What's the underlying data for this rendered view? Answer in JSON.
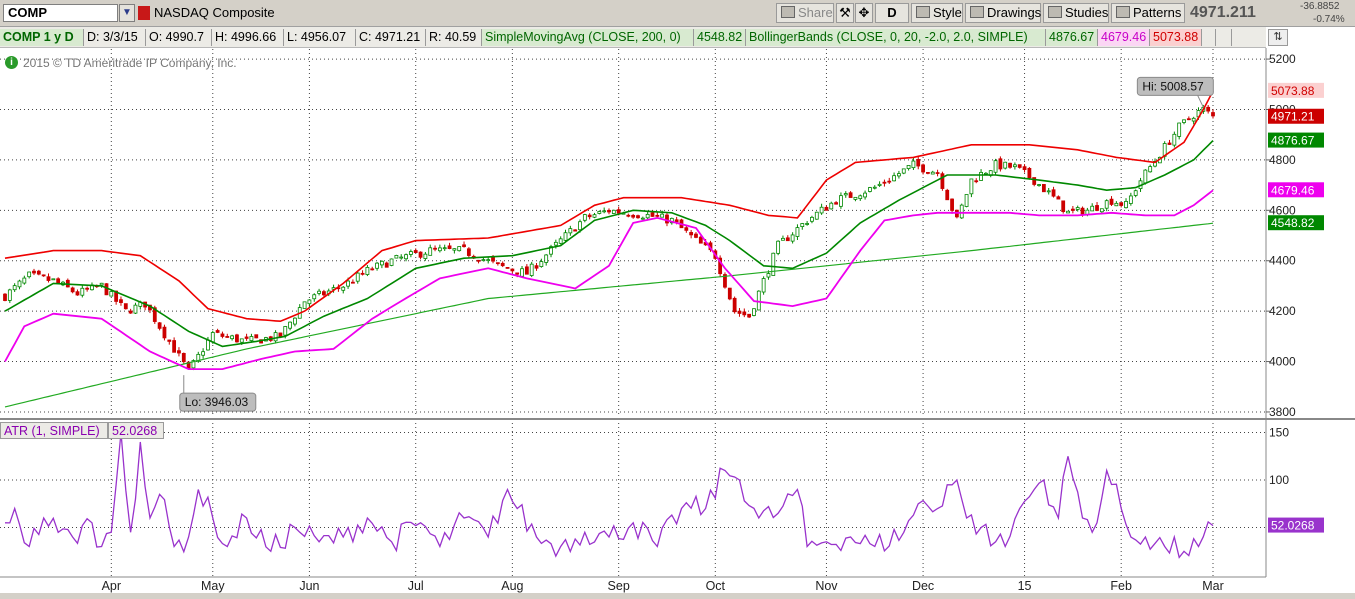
{
  "toolbar": {
    "symbol": "COMP",
    "symbol_name": "NASDAQ Composite",
    "share_label": "Share",
    "d_label": "D",
    "style_label": "Style",
    "drawings_label": "Drawings",
    "studies_label": "Studies",
    "patterns_label": "Patterns",
    "last_price": "4971.211",
    "net_change": "-36.8852",
    "pct_change": "-0.74%"
  },
  "info_bar": {
    "symbol_period": "COMP 1 y D",
    "date": "D: 3/3/15",
    "open": "O: 4990.7",
    "high": "H: 4996.66",
    "low": "L: 4956.07",
    "close": "C: 4971.21",
    "range": "R: 40.59",
    "sma_label": "SimpleMovingAvg (CLOSE, 200, 0)",
    "sma_value": "4548.82",
    "bb_label": "BollingerBands (CLOSE, 0, 20, -2.0, 2.0, SIMPLE)",
    "bb_mid_value": "4876.67",
    "bb_lower_value": "4679.46",
    "bb_upper_value": "5073.88"
  },
  "copyright": "2015 © TD Ameritrade IP Company, Inc.",
  "atr_panel": {
    "label": "ATR (1, SIMPLE)",
    "value": "52.0268"
  },
  "colors": {
    "up_candle": "#008800",
    "down_candle": "#cc0000",
    "bb_upper": "#ee0000",
    "bb_middle": "#008800",
    "bb_lower": "#ee00ee",
    "sma": "#22aa22",
    "atr": "#9933cc"
  },
  "chart_data": [
    {
      "type": "candlestick",
      "title": "NASDAQ Composite",
      "ylim": [
        3780,
        5240
      ],
      "yticks": [
        3800,
        4000,
        4200,
        4400,
        4600,
        4800,
        5000,
        5200
      ],
      "month_labels": [
        "Apr",
        "May",
        "Jun",
        "Jul",
        "Aug",
        "Sep",
        "Oct",
        "Nov",
        "Dec",
        "15",
        "Feb",
        "Mar"
      ],
      "month_start_index": [
        22,
        43,
        63,
        85,
        105,
        127,
        147,
        170,
        190,
        211,
        231,
        250
      ],
      "n_bars": 251,
      "grid": true,
      "close_keypoints": [
        [
          0,
          4260
        ],
        [
          5,
          4340
        ],
        [
          10,
          4320
        ],
        [
          15,
          4270
        ],
        [
          20,
          4300
        ],
        [
          25,
          4200
        ],
        [
          29,
          4230
        ],
        [
          35,
          4050
        ],
        [
          38,
          3960
        ],
        [
          43,
          4110
        ],
        [
          50,
          4080
        ],
        [
          57,
          4100
        ],
        [
          62,
          4240
        ],
        [
          70,
          4300
        ],
        [
          75,
          4360
        ],
        [
          80,
          4400
        ],
        [
          84,
          4420
        ],
        [
          88,
          4440
        ],
        [
          95,
          4440
        ],
        [
          102,
          4380
        ],
        [
          108,
          4350
        ],
        [
          115,
          4480
        ],
        [
          120,
          4570
        ],
        [
          125,
          4600
        ],
        [
          133,
          4580
        ],
        [
          138,
          4560
        ],
        [
          143,
          4480
        ],
        [
          147,
          4420
        ],
        [
          151,
          4200
        ],
        [
          154,
          4180
        ],
        [
          160,
          4460
        ],
        [
          166,
          4560
        ],
        [
          172,
          4640
        ],
        [
          180,
          4690
        ],
        [
          188,
          4780
        ],
        [
          193,
          4750
        ],
        [
          197,
          4560
        ],
        [
          200,
          4720
        ],
        [
          205,
          4780
        ],
        [
          209,
          4770
        ],
        [
          213,
          4720
        ],
        [
          217,
          4650
        ],
        [
          220,
          4590
        ],
        [
          224,
          4600
        ],
        [
          229,
          4640
        ],
        [
          232,
          4620
        ],
        [
          235,
          4720
        ],
        [
          240,
          4850
        ],
        [
          243,
          4930
        ],
        [
          246,
          4980
        ],
        [
          248,
          5000
        ],
        [
          250,
          4971.21
        ]
      ],
      "series": [
        {
          "name": "SimpleMovingAvg (CLOSE, 200, 0)",
          "last": 4548.82,
          "keypoints": [
            [
              0,
              3820
            ],
            [
              50,
              4050
            ],
            [
              100,
              4250
            ],
            [
              150,
              4340
            ],
            [
              200,
              4440
            ],
            [
              250,
              4548.82
            ]
          ]
        },
        {
          "name": "BollingerBands upper",
          "last": 5073.88,
          "keypoints": [
            [
              0,
              4410
            ],
            [
              10,
              4440
            ],
            [
              20,
              4440
            ],
            [
              28,
              4420
            ],
            [
              36,
              4320
            ],
            [
              42,
              4210
            ],
            [
              50,
              4170
            ],
            [
              57,
              4160
            ],
            [
              62,
              4200
            ],
            [
              70,
              4310
            ],
            [
              78,
              4440
            ],
            [
              85,
              4480
            ],
            [
              100,
              4490
            ],
            [
              115,
              4540
            ],
            [
              122,
              4620
            ],
            [
              128,
              4650
            ],
            [
              140,
              4650
            ],
            [
              150,
              4620
            ],
            [
              158,
              4580
            ],
            [
              164,
              4570
            ],
            [
              170,
              4720
            ],
            [
              176,
              4790
            ],
            [
              188,
              4810
            ],
            [
              200,
              4860
            ],
            [
              212,
              4860
            ],
            [
              222,
              4840
            ],
            [
              230,
              4810
            ],
            [
              238,
              4790
            ],
            [
              244,
              4870
            ],
            [
              248,
              5000
            ],
            [
              250,
              5073.88
            ]
          ]
        },
        {
          "name": "BollingerBands middle",
          "last": 4876.67,
          "keypoints": [
            [
              0,
              4200
            ],
            [
              10,
              4310
            ],
            [
              20,
              4300
            ],
            [
              30,
              4220
            ],
            [
              38,
              4120
            ],
            [
              45,
              4060
            ],
            [
              52,
              4080
            ],
            [
              58,
              4100
            ],
            [
              66,
              4180
            ],
            [
              75,
              4250
            ],
            [
              85,
              4370
            ],
            [
              95,
              4410
            ],
            [
              105,
              4420
            ],
            [
              115,
              4460
            ],
            [
              122,
              4560
            ],
            [
              130,
              4600
            ],
            [
              138,
              4590
            ],
            [
              145,
              4540
            ],
            [
              150,
              4480
            ],
            [
              157,
              4380
            ],
            [
              163,
              4370
            ],
            [
              170,
              4430
            ],
            [
              177,
              4550
            ],
            [
              185,
              4640
            ],
            [
              195,
              4740
            ],
            [
              205,
              4740
            ],
            [
              214,
              4720
            ],
            [
              222,
              4700
            ],
            [
              228,
              4680
            ],
            [
              234,
              4690
            ],
            [
              240,
              4740
            ],
            [
              246,
              4800
            ],
            [
              250,
              4876.67
            ]
          ]
        },
        {
          "name": "BollingerBands lower",
          "last": 4679.46,
          "keypoints": [
            [
              0,
              4000
            ],
            [
              4,
              4140
            ],
            [
              10,
              4190
            ],
            [
              20,
              4170
            ],
            [
              30,
              4040
            ],
            [
              38,
              3970
            ],
            [
              45,
              3970
            ],
            [
              53,
              4010
            ],
            [
              60,
              4040
            ],
            [
              68,
              4050
            ],
            [
              76,
              4170
            ],
            [
              82,
              4240
            ],
            [
              90,
              4330
            ],
            [
              100,
              4370
            ],
            [
              108,
              4330
            ],
            [
              118,
              4290
            ],
            [
              125,
              4380
            ],
            [
              130,
              4550
            ],
            [
              135,
              4570
            ],
            [
              143,
              4530
            ],
            [
              149,
              4370
            ],
            [
              155,
              4240
            ],
            [
              163,
              4220
            ],
            [
              170,
              4250
            ],
            [
              177,
              4440
            ],
            [
              182,
              4560
            ],
            [
              188,
              4580
            ],
            [
              193,
              4590
            ],
            [
              200,
              4590
            ],
            [
              208,
              4590
            ],
            [
              214,
              4580
            ],
            [
              222,
              4580
            ],
            [
              229,
              4590
            ],
            [
              236,
              4580
            ],
            [
              242,
              4580
            ],
            [
              246,
              4620
            ],
            [
              250,
              4679.46
            ]
          ]
        }
      ],
      "annotations": [
        {
          "text": "Hi: 5008.57",
          "index": 248,
          "value": 5008.57
        },
        {
          "text": "Lo: 3946.03",
          "index": 37,
          "value": 3946.03
        }
      ]
    },
    {
      "type": "line",
      "name": "ATR (1, SIMPLE)",
      "ylim": [
        0,
        160
      ],
      "yticks": [
        50,
        100,
        150
      ],
      "last": 52.0268,
      "keypoints": [
        [
          0,
          55
        ],
        [
          2,
          70
        ],
        [
          5,
          30
        ],
        [
          8,
          60
        ],
        [
          11,
          45
        ],
        [
          14,
          40
        ],
        [
          18,
          55
        ],
        [
          20,
          30
        ],
        [
          22,
          45
        ],
        [
          24,
          150
        ],
        [
          26,
          45
        ],
        [
          28,
          140
        ],
        [
          30,
          60
        ],
        [
          32,
          85
        ],
        [
          35,
          30
        ],
        [
          38,
          40
        ],
        [
          40,
          90
        ],
        [
          43,
          60
        ],
        [
          46,
          30
        ],
        [
          50,
          60
        ],
        [
          55,
          25
        ],
        [
          60,
          50
        ],
        [
          65,
          35
        ],
        [
          70,
          40
        ],
        [
          75,
          60
        ],
        [
          80,
          35
        ],
        [
          86,
          55
        ],
        [
          90,
          30
        ],
        [
          95,
          60
        ],
        [
          100,
          40
        ],
        [
          104,
          90
        ],
        [
          106,
          70
        ],
        [
          110,
          40
        ],
        [
          115,
          30
        ],
        [
          120,
          45
        ],
        [
          125,
          40
        ],
        [
          130,
          55
        ],
        [
          135,
          30
        ],
        [
          140,
          70
        ],
        [
          145,
          70
        ],
        [
          149,
          110
        ],
        [
          152,
          100
        ],
        [
          156,
          60
        ],
        [
          160,
          65
        ],
        [
          164,
          90
        ],
        [
          166,
          30
        ],
        [
          170,
          35
        ],
        [
          175,
          40
        ],
        [
          180,
          30
        ],
        [
          186,
          45
        ],
        [
          189,
          75
        ],
        [
          193,
          70
        ],
        [
          195,
          95
        ],
        [
          197,
          100
        ],
        [
          199,
          60
        ],
        [
          202,
          50
        ],
        [
          205,
          35
        ],
        [
          207,
          30
        ],
        [
          210,
          70
        ],
        [
          213,
          90
        ],
        [
          215,
          100
        ],
        [
          218,
          60
        ],
        [
          220,
          125
        ],
        [
          223,
          60
        ],
        [
          226,
          55
        ],
        [
          228,
          110
        ],
        [
          231,
          70
        ],
        [
          233,
          40
        ],
        [
          236,
          40
        ],
        [
          240,
          30
        ],
        [
          244,
          25
        ],
        [
          247,
          30
        ],
        [
          250,
          52.03
        ]
      ]
    }
  ]
}
